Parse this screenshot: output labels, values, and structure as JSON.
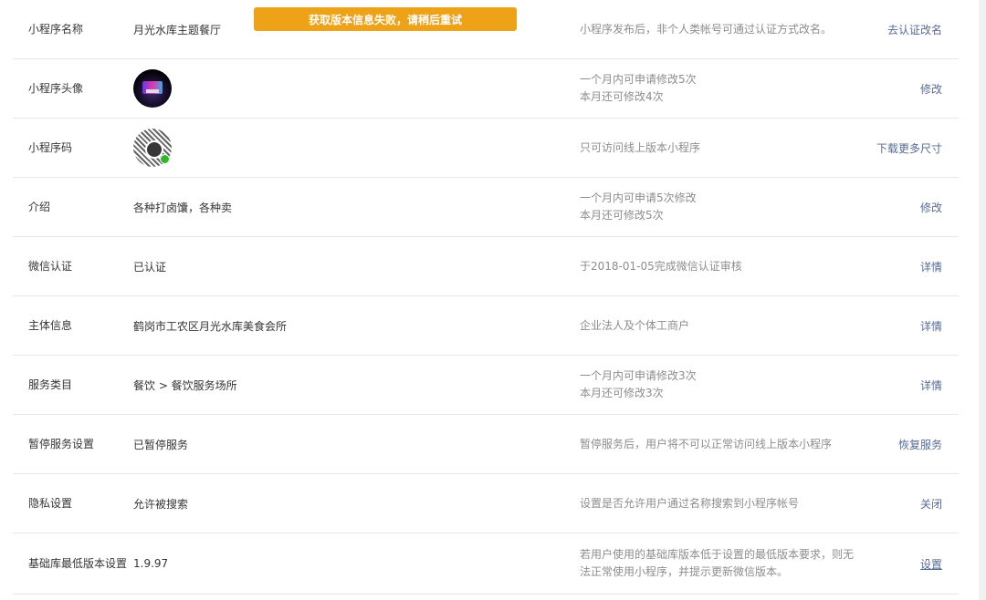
{
  "toast": {
    "text": "获取版本信息失败，请稍后重试",
    "color": "#eda218"
  },
  "accent_color": "#576b95",
  "rows": [
    {
      "label": "小程序名称",
      "value": "月光水库主题餐厅",
      "desc": [
        "小程序发布后，非个人类帐号可通过认证方式改名。"
      ],
      "action": "去认证改名"
    },
    {
      "label": "小程序头像",
      "value": "",
      "image": "avatar-image",
      "desc": [
        "一个月内可申请修改5次",
        "本月还可修改4次"
      ],
      "action": "修改"
    },
    {
      "label": "小程序码",
      "value": "",
      "image": "qrcode-image",
      "desc": [
        "只可访问线上版本小程序"
      ],
      "action": "下载更多尺寸"
    },
    {
      "label": "介绍",
      "value": "各种打卤馕，各种卖",
      "desc": [
        "一个月内可申请5次修改",
        "本月还可修改5次"
      ],
      "action": "修改"
    },
    {
      "label": "微信认证",
      "value": "已认证",
      "desc": [
        "于2018-01-05完成微信认证审核"
      ],
      "action": "详情"
    },
    {
      "label": "主体信息",
      "value": "鹤岗市工农区月光水库美食会所",
      "desc": [
        "企业法人及个体工商户"
      ],
      "action": "详情"
    },
    {
      "label": "服务类目",
      "value": "餐饮 > 餐饮服务场所",
      "desc": [
        "一个月内可申请修改3次",
        "本月还可修改3次"
      ],
      "action": "详情"
    },
    {
      "label": "暂停服务设置",
      "value": "已暂停服务",
      "desc": [
        "暂停服务后，用户将不可以正常访问线上版本小程序"
      ],
      "action": "恢复服务"
    },
    {
      "label": "隐私设置",
      "value": "允许被搜索",
      "desc": [
        "设置是否允许用户通过名称搜索到小程序帐号"
      ],
      "action": "关闭"
    },
    {
      "label": "基础库最低版本设置",
      "value": "1.9.97",
      "desc": [
        "若用户使用的基础库版本低于设置的最低版本要求，则无",
        "法正常使用小程序，并提示更新微信版本。"
      ],
      "action": "设置"
    }
  ]
}
